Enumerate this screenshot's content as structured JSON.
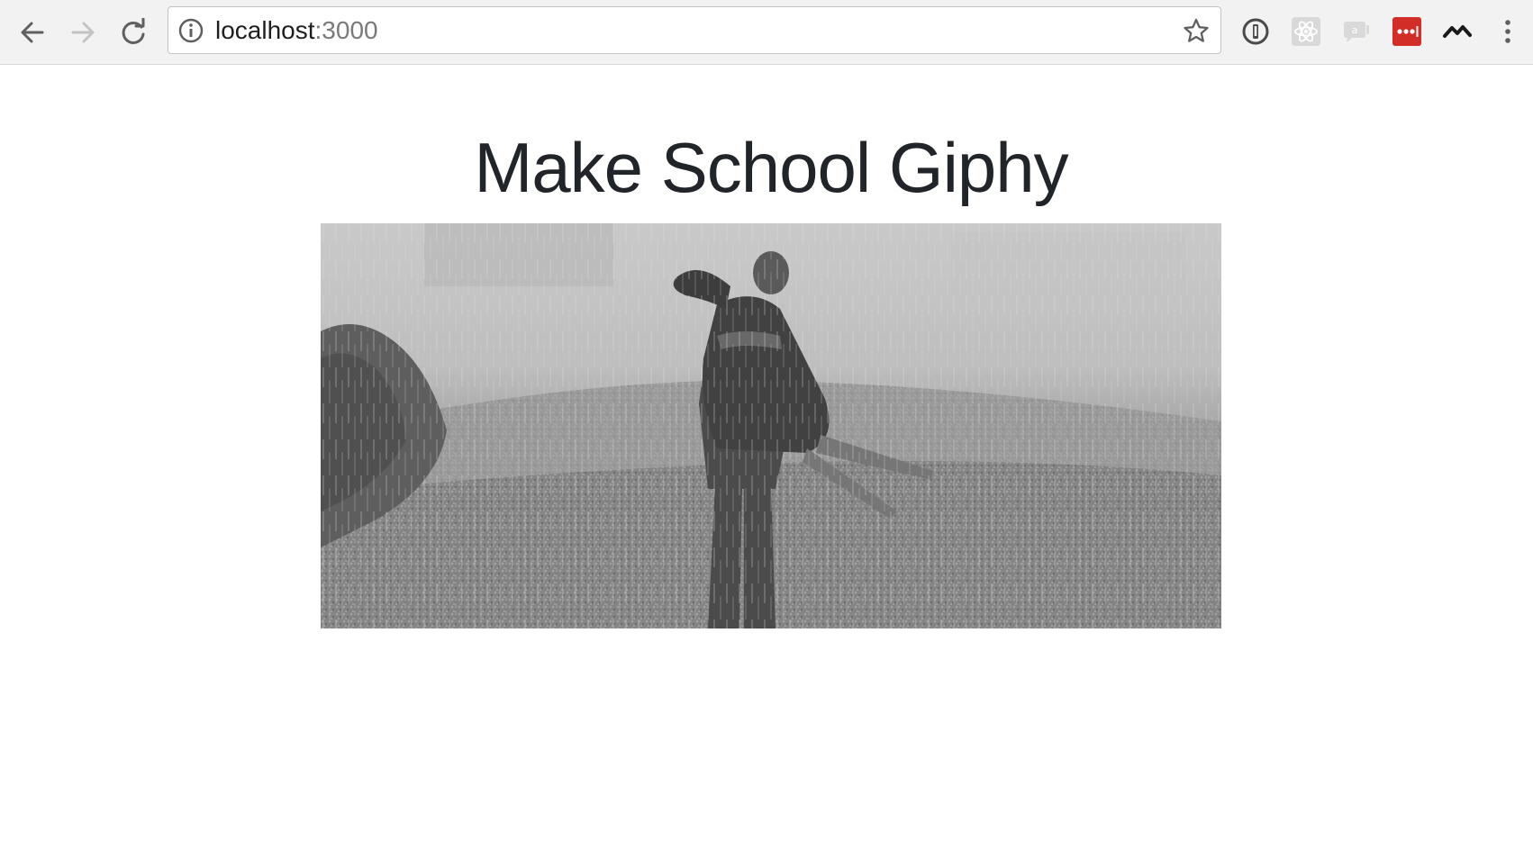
{
  "browser": {
    "url_host": "localhost",
    "url_port": ":3000",
    "back_icon": "arrow-left-icon",
    "forward_icon": "arrow-right-icon",
    "reload_icon": "reload-icon",
    "info_icon": "info-icon",
    "star_icon": "star-icon",
    "extensions": [
      {
        "name": "onepassword-icon"
      },
      {
        "name": "react-devtools-icon"
      },
      {
        "name": "cast-icon"
      },
      {
        "name": "lastpass-icon",
        "color": "#d32d27"
      },
      {
        "name": "momentum-icon"
      }
    ],
    "menu_icon": "kebab-menu-icon"
  },
  "page": {
    "title": "Make School Giphy"
  },
  "colors": {
    "toolbar_bg": "#f2f2f2",
    "title_color": "#212529",
    "lastpass_red": "#d32d27"
  }
}
